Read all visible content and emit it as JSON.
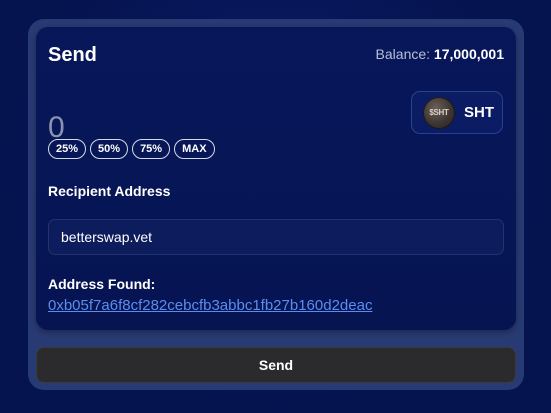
{
  "send_card": {
    "title": "Send",
    "balance_label": "Balance:",
    "balance_value": "17,000,001",
    "amount": {
      "value": "",
      "placeholder": "0"
    },
    "token": {
      "logo_text": "$SHT",
      "symbol": "SHT"
    },
    "percent_buttons": [
      "25%",
      "50%",
      "75%",
      "MAX"
    ],
    "recipient_label": "Recipient Address",
    "recipient_value": "betterswap.vet",
    "address_found_label": "Address Found:",
    "address_found_value": "0xb05f7a6f8cf282cebcfb3abbc1fb27b160d2deac"
  },
  "send_button_label": "Send",
  "colors": {
    "page_bg": "#05134f",
    "card_bg": "#07175a",
    "link": "#5b8df0",
    "button_bg": "#2b2b2d"
  }
}
